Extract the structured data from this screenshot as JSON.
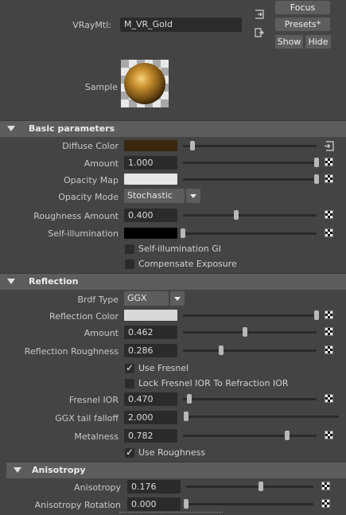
{
  "header": {
    "material_label": "VRayMtl:",
    "material_name": "M_VR_Gold",
    "focus_label": "Focus",
    "presets_label": "Presets*",
    "show_label": "Show",
    "hide_label": "Hide",
    "sample_label": "Sample"
  },
  "basic": {
    "title": "Basic parameters",
    "diffuse_label": "Diffuse Color",
    "diffuse_color": "#3a2710",
    "amount_label": "Amount",
    "amount_value": "1.000",
    "opacity_map_label": "Opacity Map",
    "opacity_map_color": "#e6e6e6",
    "opacity_mode_label": "Opacity Mode",
    "opacity_mode_value": "Stochastic",
    "roughness_label": "Roughness Amount",
    "roughness_value": "0.400",
    "self_illum_label": "Self-illumination",
    "self_illum_color": "#000000",
    "self_illum_gi_label": "Self-illumination GI",
    "compensate_label": "Compensate Exposure"
  },
  "reflection": {
    "title": "Reflection",
    "brdf_label": "Brdf Type",
    "brdf_value": "GGX",
    "refl_color_label": "Reflection Color",
    "refl_color": "#d8d8d8",
    "amount_label": "Amount",
    "amount_value": "0.462",
    "refl_rough_label": "Reflection Roughness",
    "refl_rough_value": "0.286",
    "use_fresnel_label": "Use Fresnel",
    "lock_fresnel_label": "Lock Fresnel IOR To Refraction IOR",
    "fresnel_ior_label": "Fresnel IOR",
    "fresnel_ior_value": "0.470",
    "ggx_label": "GGX tail falloff",
    "ggx_value": "2.000",
    "metalness_label": "Metalness",
    "metalness_value": "0.782",
    "use_roughness_label": "Use Roughness"
  },
  "anisotropy": {
    "title": "Anisotropy",
    "aniso_label": "Anisotropy",
    "aniso_value": "0.176",
    "rotation_label": "Anisotropy Rotation",
    "rotation_value": "0.000"
  },
  "sliders": {
    "diffuse": 0.07,
    "amount": 1.0,
    "opacity_map": 1.0,
    "roughness": 0.4,
    "self_illum": 0.0,
    "refl_color": 1.0,
    "refl_amount": 0.462,
    "refl_rough": 0.286,
    "fresnel_ior": 0.047,
    "ggx": 0.0,
    "metalness": 0.782,
    "aniso": 0.588,
    "rotation": 0.0
  }
}
